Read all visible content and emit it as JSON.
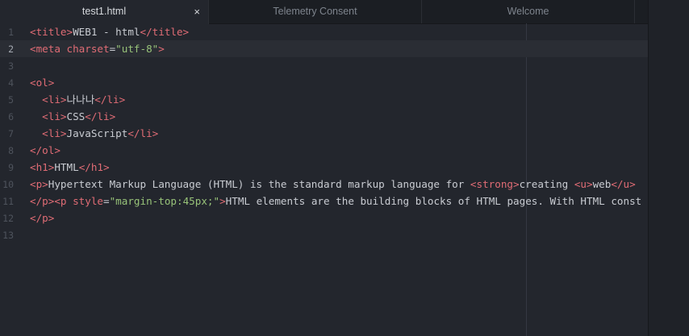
{
  "tabs": [
    {
      "label": "test1.html",
      "close": "×"
    },
    {
      "label": "Telemetry Consent"
    },
    {
      "label": "Welcome"
    }
  ],
  "editor": {
    "lines": [
      {
        "n": "1",
        "tokens": [
          [
            "tag",
            "<title>"
          ],
          [
            "text",
            "WEB1 - html"
          ],
          [
            "tag",
            "</title>"
          ]
        ]
      },
      {
        "n": "2",
        "tokens": [
          [
            "tag",
            "<meta "
          ],
          [
            "attr",
            "charset"
          ],
          [
            "text",
            "="
          ],
          [
            "str",
            "\"utf-8\""
          ],
          [
            "tag",
            ">"
          ]
        ]
      },
      {
        "n": "3",
        "tokens": []
      },
      {
        "n": "4",
        "tokens": [
          [
            "tag",
            "<ol>"
          ]
        ]
      },
      {
        "n": "5",
        "tokens": [
          [
            "text",
            "  "
          ],
          [
            "tag",
            "<li>"
          ],
          [
            "text",
            "나나나"
          ],
          [
            "tag",
            "</li>"
          ]
        ]
      },
      {
        "n": "6",
        "tokens": [
          [
            "text",
            "  "
          ],
          [
            "tag",
            "<li>"
          ],
          [
            "text",
            "CSS"
          ],
          [
            "tag",
            "</li>"
          ]
        ]
      },
      {
        "n": "7",
        "tokens": [
          [
            "text",
            "  "
          ],
          [
            "tag",
            "<li>"
          ],
          [
            "text",
            "JavaScript"
          ],
          [
            "tag",
            "</li>"
          ]
        ]
      },
      {
        "n": "8",
        "tokens": [
          [
            "tag",
            "</ol>"
          ]
        ]
      },
      {
        "n": "9",
        "tokens": [
          [
            "tag",
            "<h1>"
          ],
          [
            "text",
            "HTML"
          ],
          [
            "tag",
            "</h1>"
          ]
        ]
      },
      {
        "n": "10",
        "tokens": [
          [
            "tag",
            "<p>"
          ],
          [
            "text",
            "Hypertext Markup Language (HTML) is the standard markup language for "
          ],
          [
            "tag",
            "<strong>"
          ],
          [
            "text",
            "creating "
          ],
          [
            "tag",
            "<u>"
          ],
          [
            "text",
            "web"
          ],
          [
            "tag",
            "</u>"
          ]
        ]
      },
      {
        "n": "11",
        "tokens": [
          [
            "tag",
            "</p><p "
          ],
          [
            "attr",
            "style"
          ],
          [
            "text",
            "="
          ],
          [
            "str",
            "\"margin-top:45px;\""
          ],
          [
            "tag",
            ">"
          ],
          [
            "text",
            "HTML elements are the building blocks of HTML pages. With HTML const"
          ]
        ]
      },
      {
        "n": "12",
        "tokens": [
          [
            "tag",
            "</p>"
          ]
        ]
      },
      {
        "n": "13",
        "tokens": []
      }
    ]
  }
}
